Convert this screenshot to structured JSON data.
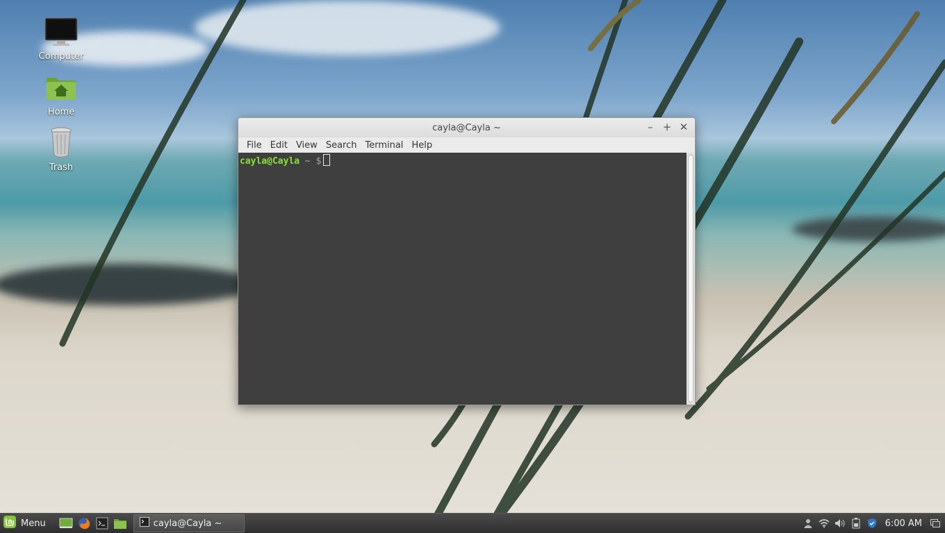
{
  "desktop": {
    "icons": [
      {
        "label": "Computer",
        "icon": "monitor-icon"
      },
      {
        "label": "Home",
        "icon": "home-folder-icon"
      },
      {
        "label": "Trash",
        "icon": "trash-icon"
      }
    ]
  },
  "window": {
    "title": "cayla@Cayla ~",
    "controls": {
      "minimize": "–",
      "maximize": "+",
      "close": "✕"
    },
    "menu": [
      "File",
      "Edit",
      "View",
      "Search",
      "Terminal",
      "Help"
    ],
    "terminal": {
      "prompt_user": "cayla@Cayla",
      "prompt_path": "~ $"
    }
  },
  "panel": {
    "menu_label": "Menu",
    "launchers": [
      "show-desktop-icon",
      "firefox-icon",
      "terminal-icon",
      "files-icon"
    ],
    "task_label": "cayla@Cayla ~",
    "tray_icons": [
      "user-icon",
      "wifi-icon",
      "volume-icon",
      "battery-icon",
      "shield-icon"
    ],
    "clock": "6:00 AM",
    "colors": {
      "prompt_green": "#8ae234",
      "mint_green": "#87c540"
    }
  }
}
